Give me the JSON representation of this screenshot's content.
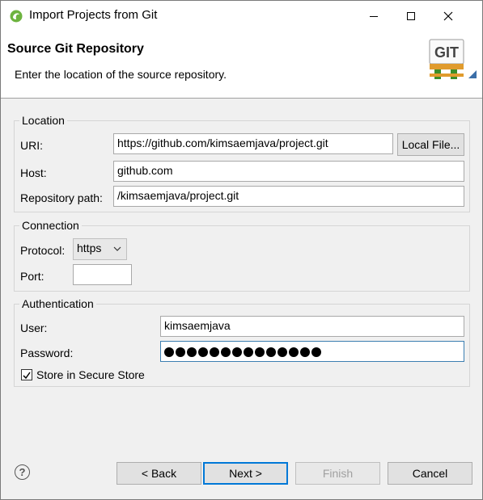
{
  "window": {
    "title": "Import Projects from Git"
  },
  "banner": {
    "title": "Source Git Repository",
    "description": "Enter the location of the source repository."
  },
  "location": {
    "legend": "Location",
    "uri_label": "URI:",
    "uri_value": "https://github.com/kimsaemjava/project.git",
    "local_file_button": "Local File...",
    "host_label": "Host:",
    "host_value": "github.com",
    "repo_path_label": "Repository path:",
    "repo_path_value": "/kimsaemjava/project.git"
  },
  "connection": {
    "legend": "Connection",
    "protocol_label": "Protocol:",
    "protocol_value": "https",
    "port_label": "Port:",
    "port_value": ""
  },
  "authentication": {
    "legend": "Authentication",
    "user_label": "User:",
    "user_value": "kimsaemjava",
    "password_label": "Password:",
    "password_mask_count": 14,
    "store_label": "Store in Secure Store",
    "store_checked": true
  },
  "footer": {
    "help_glyph": "?",
    "back_button": "< Back",
    "next_button": "Next >",
    "finish_button": "Finish",
    "cancel_button": "Cancel"
  },
  "icons": {
    "app": "eclipse-icon",
    "logo": "git-logo-icon",
    "logo_text": "GIT"
  },
  "colors": {
    "focus": "#0078d7",
    "git_green": "#3c8f2a",
    "git_orange": "#e09b2d"
  }
}
